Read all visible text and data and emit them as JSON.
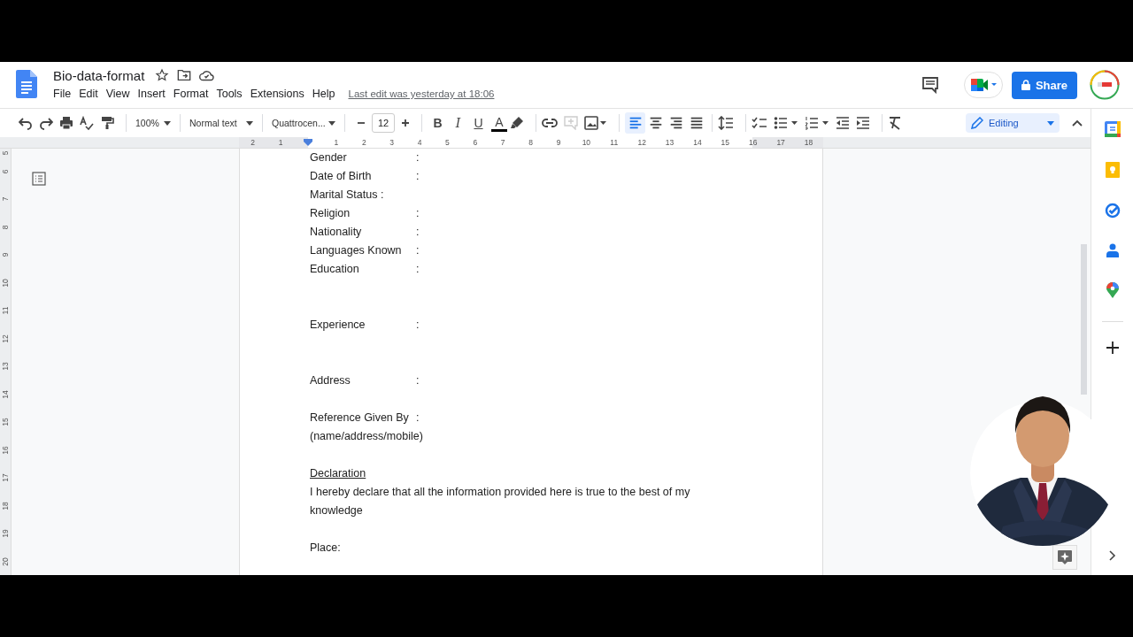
{
  "document": {
    "title": "Bio-data-format"
  },
  "menu": [
    "File",
    "Edit",
    "View",
    "Insert",
    "Format",
    "Tools",
    "Extensions",
    "Help"
  ],
  "last_edit": "Last edit was yesterday at 18:06",
  "share": {
    "label": "Share"
  },
  "toolbar": {
    "zoom": "100%",
    "style": "Normal text",
    "font": "Quattrocen...",
    "font_size": "12",
    "format_buttons": [
      "B",
      "I",
      "U",
      "A"
    ],
    "alignments": [
      {
        "selected": true
      },
      {
        "selected": false
      },
      {
        "selected": false
      },
      {
        "selected": false
      }
    ],
    "mode": "Editing"
  },
  "ruler": {
    "horizontal": [
      "2",
      "1",
      "1",
      "2",
      "3",
      "4",
      "5",
      "6",
      "7",
      "8",
      "9",
      "10",
      "11",
      "12",
      "13",
      "14",
      "15",
      "16",
      "17",
      "18"
    ],
    "vertical": [
      "5",
      "6",
      "7",
      "8",
      "9",
      "10",
      "11",
      "12",
      "13",
      "14",
      "15",
      "16",
      "17",
      "18",
      "19",
      "20"
    ]
  },
  "lines": [
    {
      "kind": "field",
      "label": "Gender",
      "separator": ":"
    },
    {
      "kind": "field",
      "label": "Date of Birth",
      "separator": ":"
    },
    {
      "kind": "text",
      "text": "Marital Status :"
    },
    {
      "kind": "field",
      "label": "Religion",
      "separator": ":"
    },
    {
      "kind": "field",
      "label": "Nationality",
      "separator": ":"
    },
    {
      "kind": "field",
      "label": "Languages Known",
      "separator": ":"
    },
    {
      "kind": "field",
      "label": "Education",
      "separator": ":"
    },
    {
      "kind": "blank"
    },
    {
      "kind": "blank"
    },
    {
      "kind": "field",
      "label": "Experience",
      "separator": ":"
    },
    {
      "kind": "blank"
    },
    {
      "kind": "blank"
    },
    {
      "kind": "field",
      "label": "Address",
      "separator": ":"
    },
    {
      "kind": "blank"
    },
    {
      "kind": "field",
      "label": "Reference Given By",
      "separator": ":"
    },
    {
      "kind": "text",
      "text": "(name/address/mobile)"
    },
    {
      "kind": "blank"
    },
    {
      "kind": "heading",
      "text": "Declaration"
    },
    {
      "kind": "text",
      "text": "I hereby declare that all the information provided here is true to the best of my knowledge"
    },
    {
      "kind": "blank"
    },
    {
      "kind": "text",
      "text": "Place:"
    }
  ]
}
